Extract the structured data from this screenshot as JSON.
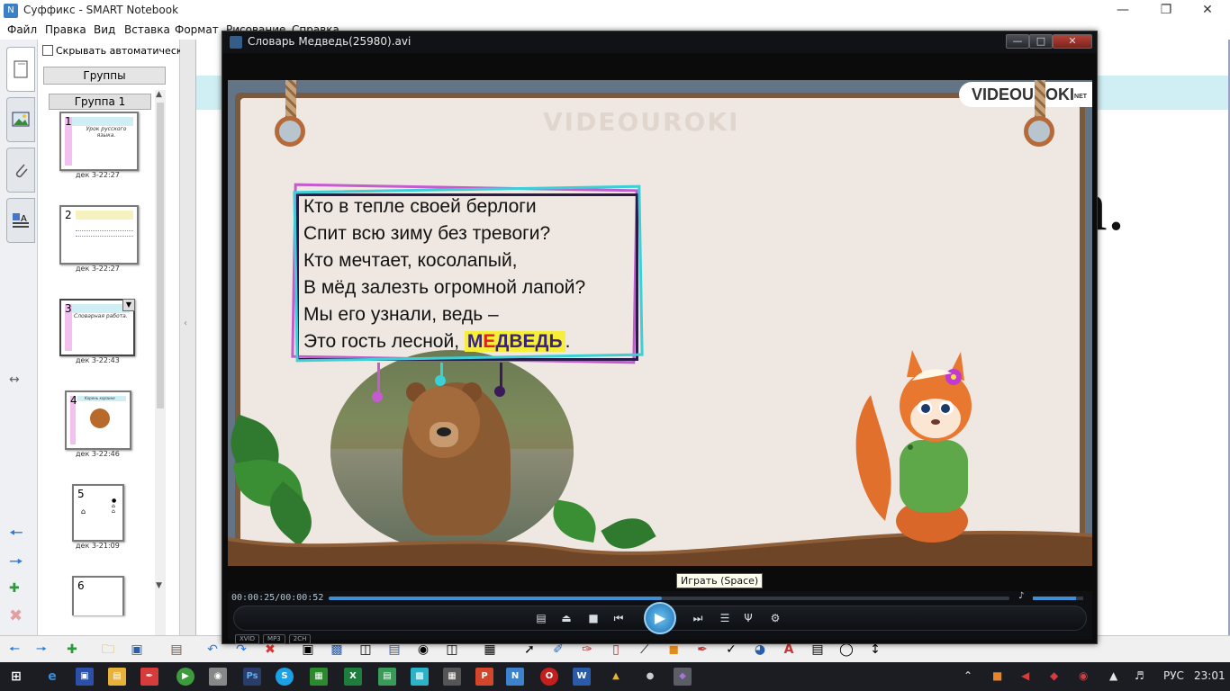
{
  "window": {
    "title": "Суффикс - SMART Notebook"
  },
  "menu": [
    "Файл",
    "Правка",
    "Вид",
    "Вставка",
    "Формат",
    "Рисование",
    "Справка"
  ],
  "sorter": {
    "autohide_label": "Скрывать автоматическ",
    "groups_button": "Группы",
    "group_header": "Группа 1",
    "pages": [
      {
        "num": "1",
        "time": "дек 3-22:27",
        "preview": "Урок русского языка."
      },
      {
        "num": "2",
        "time": "дек 3-22:27",
        "preview": ""
      },
      {
        "num": "3",
        "time": "дек 3-22:43",
        "preview": "Словарная работа."
      },
      {
        "num": "4",
        "time": "дек 3-22:46",
        "preview": "Корень корзине"
      },
      {
        "num": "5",
        "time": "дек 3-21:09",
        "preview": ""
      },
      {
        "num": "6",
        "time": "",
        "preview": ""
      }
    ]
  },
  "canvas": {
    "big_text": "а."
  },
  "player": {
    "title": "Словарь Медведь(25980).avi",
    "watermark": "VIDEOUROKI",
    "logo": "VIDEOUROKI",
    "logo_suffix": "NET",
    "poem": [
      "Кто в тепле своей берлоги",
      "Спит всю зиму без тревоги?",
      "Кто мечтает, косолапый,",
      "В мёд залезть огромной лапой?",
      "Мы его узнали, ведь –",
      "Это гость лесной, "
    ],
    "answer_pre": "М",
    "answer_red": "Е",
    "answer_post": "ДВЕДЬ",
    "answer_end": ".",
    "tooltip": "Играть (Space)",
    "time": "00:00:25/00:00:52",
    "progress": 0.49,
    "volume": 0.85,
    "codecs": [
      "XVID",
      "MP3",
      "2CH"
    ]
  },
  "taskbar": {
    "lang": "РУС",
    "clock": "23:01"
  }
}
